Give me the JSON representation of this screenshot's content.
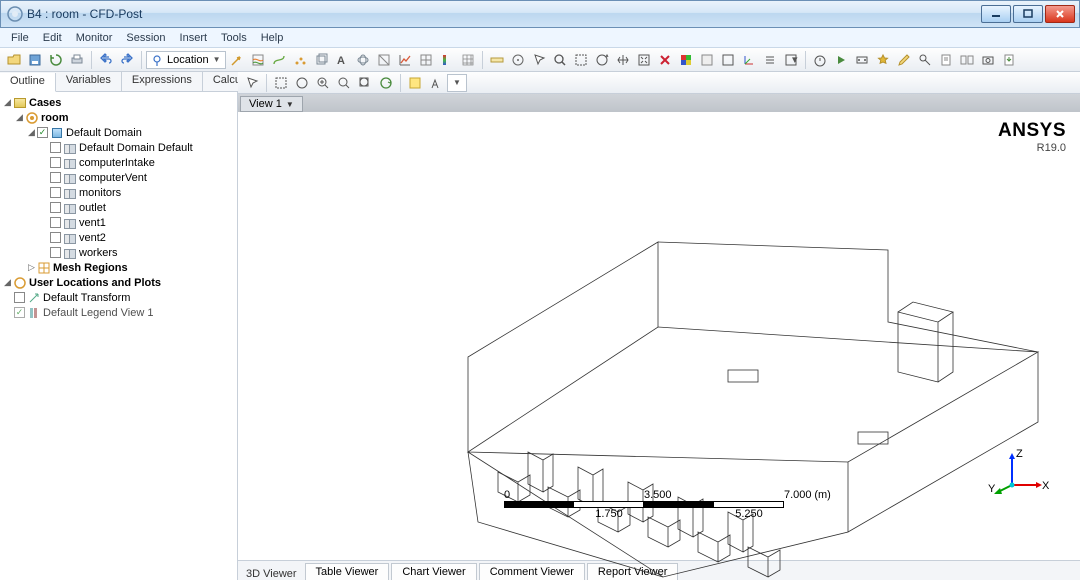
{
  "title": "B4 : room - CFD-Post",
  "menus": [
    "File",
    "Edit",
    "Monitor",
    "Session",
    "Insert",
    "Tools",
    "Help"
  ],
  "location_label": "Location",
  "side_tabs": [
    "Outline",
    "Variables",
    "Expressions",
    "Calculators"
  ],
  "active_side_tab": 0,
  "tree": {
    "cases": "Cases",
    "room": "room",
    "default_domain": "Default Domain",
    "items": [
      "Default Domain Default",
      "computerIntake",
      "computerVent",
      "monitors",
      "outlet",
      "vent1",
      "vent2",
      "workers"
    ],
    "mesh_regions": "Mesh Regions",
    "user_loc": "User Locations and Plots",
    "default_transform": "Default Transform",
    "default_legend": "Default Legend View 1"
  },
  "view_tab": "View 1",
  "brand": {
    "name": "ANSYS",
    "version": "R19.0"
  },
  "axes": {
    "x": "X",
    "y": "Y",
    "z": "Z"
  },
  "scale": {
    "v0": "0",
    "v1": "1.750",
    "v2": "3.500",
    "v3": "5.250",
    "v4": "7.000",
    "unit": "(m)"
  },
  "bottom_tabs": {
    "current": "3D Viewer",
    "others": [
      "Table Viewer",
      "Chart Viewer",
      "Comment Viewer",
      "Report Viewer"
    ]
  }
}
